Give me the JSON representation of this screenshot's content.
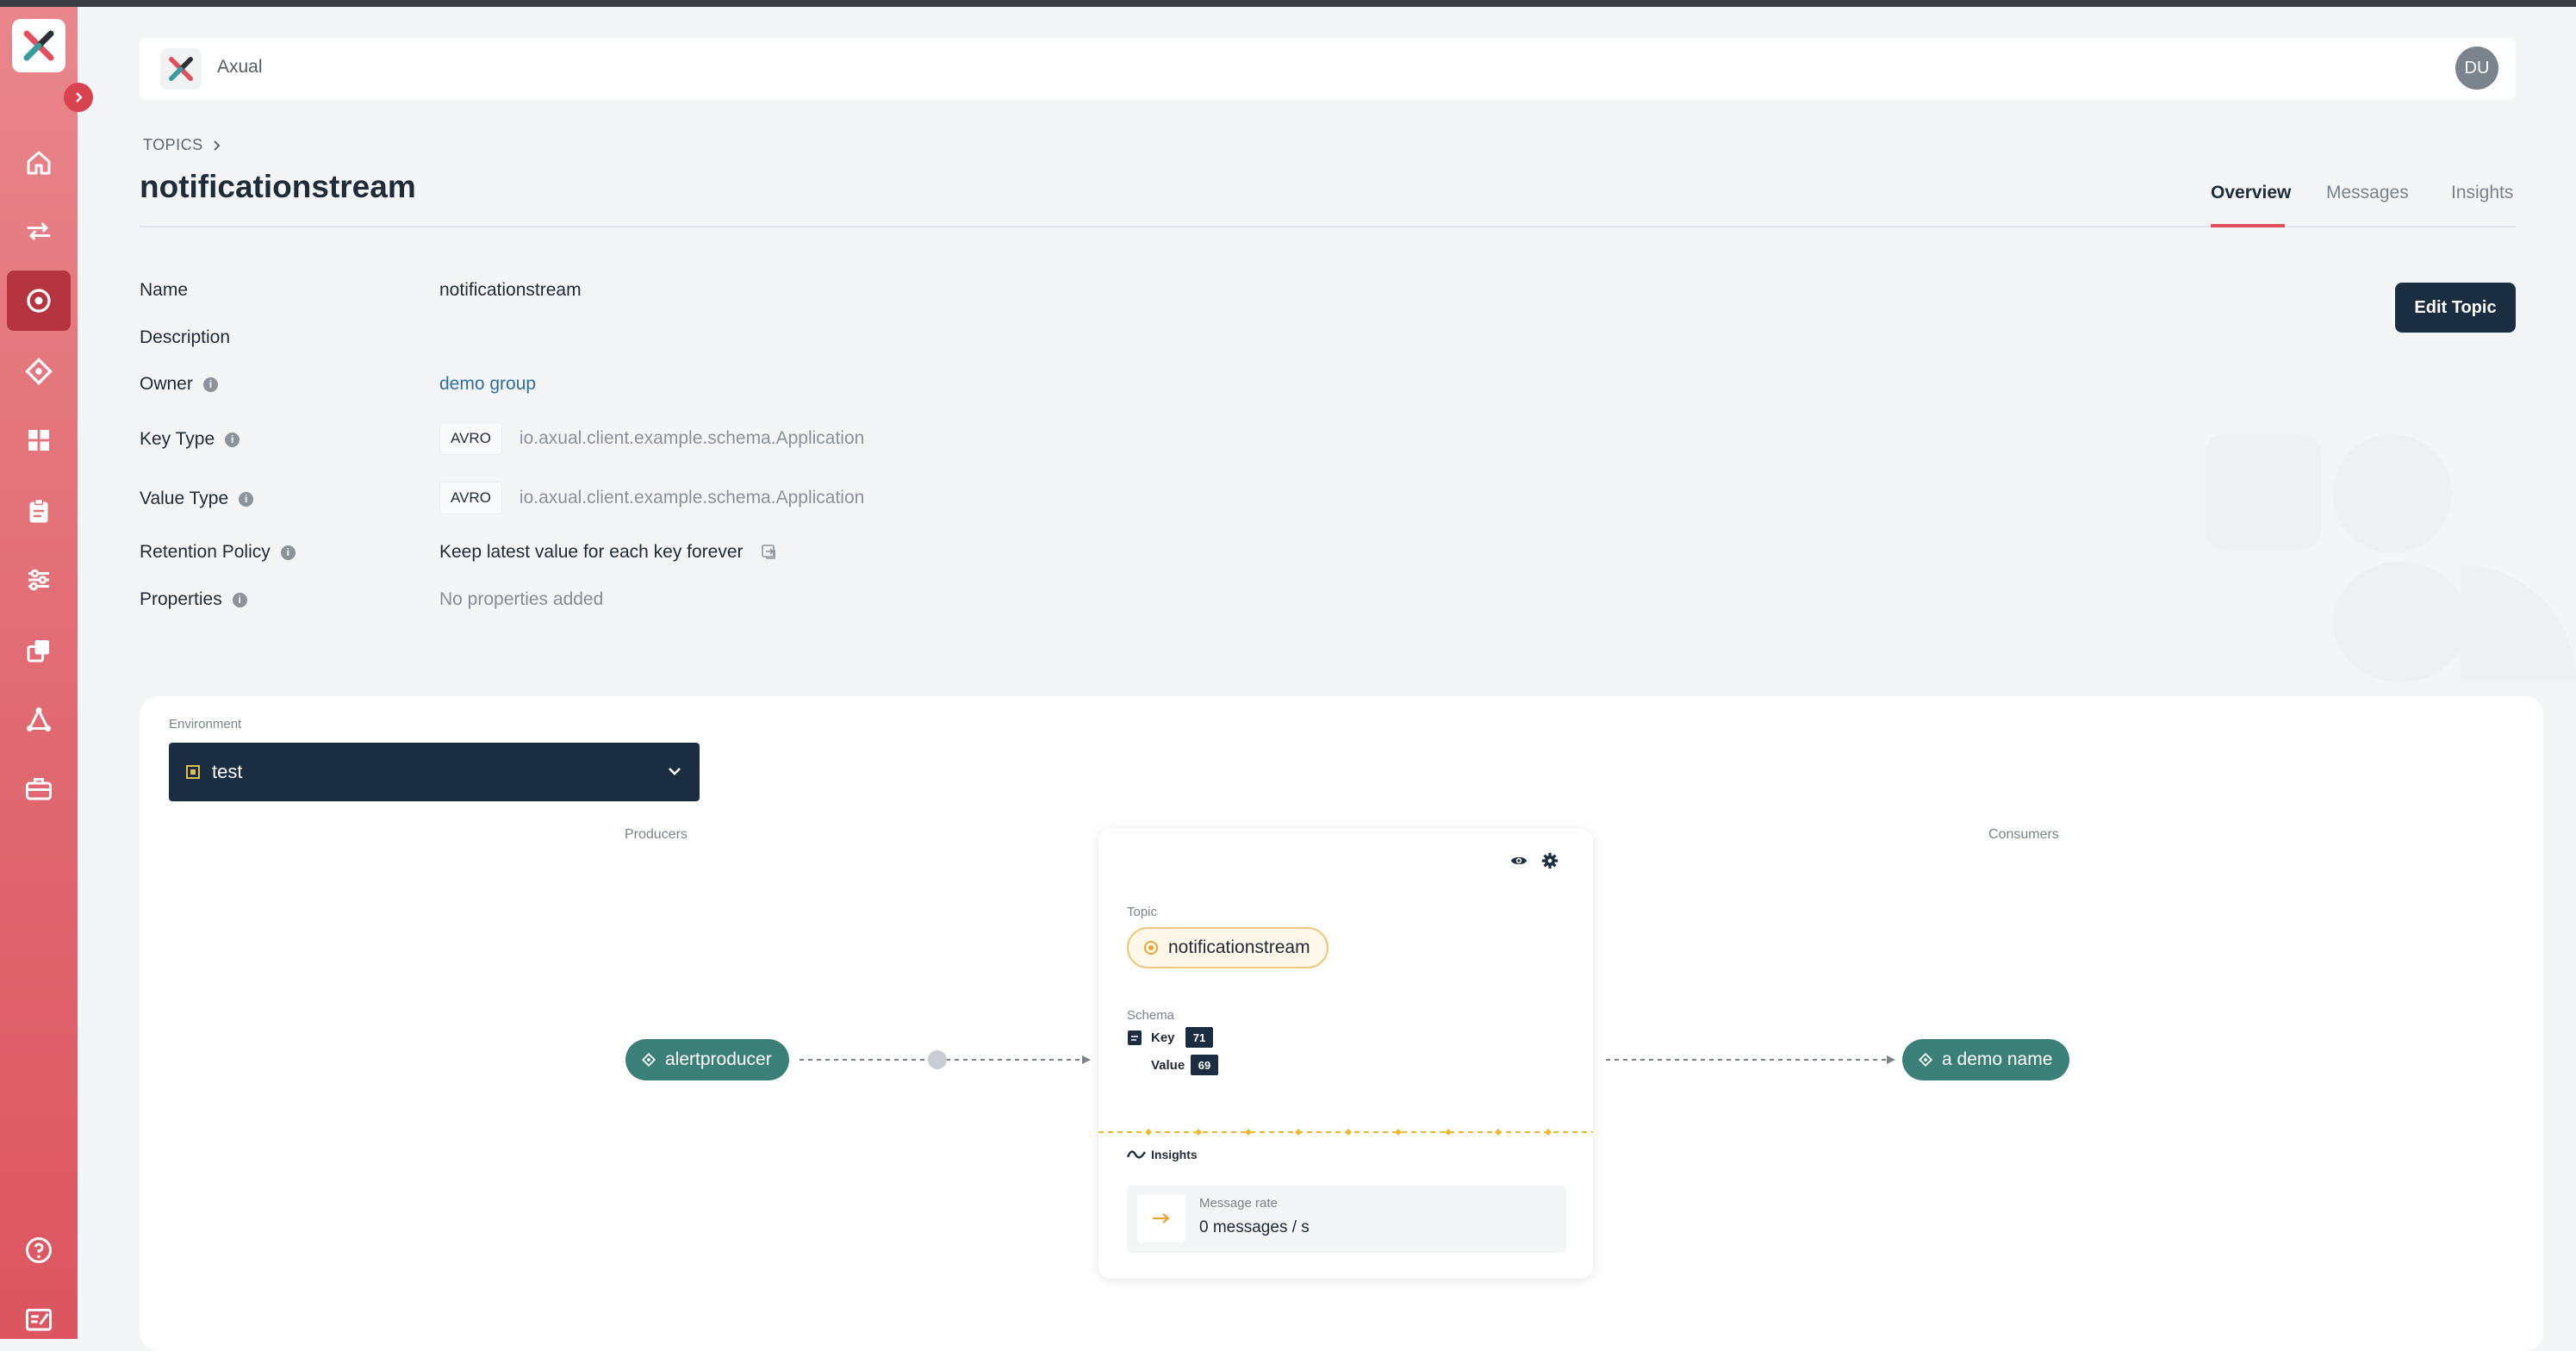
{
  "header": {
    "brand": "Axual",
    "avatar_initials": "DU"
  },
  "breadcrumb": {
    "section": "TOPICS"
  },
  "page": {
    "title": "notificationstream"
  },
  "tabs": [
    {
      "label": "Overview",
      "active": true
    },
    {
      "label": "Messages",
      "active": false
    },
    {
      "label": "Insights",
      "active": false
    }
  ],
  "actions": {
    "edit_label": "Edit Topic"
  },
  "properties": {
    "name_label": "Name",
    "name_value": "notificationstream",
    "description_label": "Description",
    "owner_label": "Owner",
    "owner_value": "demo group",
    "key_type_label": "Key Type",
    "key_type_badge": "AVRO",
    "key_type_name": "io.axual.client.example.schema.Application",
    "value_type_label": "Value Type",
    "value_type_badge": "AVRO",
    "value_type_name": "io.axual.client.example.schema.Application",
    "retention_label": "Retention Policy",
    "retention_value": "Keep latest value for each key forever",
    "properties_label": "Properties",
    "properties_value": "No properties added"
  },
  "environment": {
    "label": "Environment",
    "selected": "test"
  },
  "flow": {
    "producers_label": "Producers",
    "consumers_label": "Consumers",
    "producer": "alertproducer",
    "consumer": "a demo name",
    "topic_card": {
      "topic_label": "Topic",
      "topic_name": "notificationstream",
      "schema_label": "Schema",
      "key_label": "Key",
      "key_version": "71",
      "value_label": "Value",
      "value_version": "69",
      "insights_label": "Insights",
      "message_rate_label": "Message rate",
      "message_rate_value": "0 messages / s"
    }
  },
  "colors": {
    "sidebar": "#e26e76",
    "accent": "#e05060",
    "primary": "#1b2d40",
    "node": "#3a7f78",
    "topic_ring": "#e8a537"
  },
  "icons": {
    "sidebar": [
      "home-icon",
      "streams-icon",
      "topics-icon",
      "applications-icon",
      "dashboard-icon",
      "clipboard-icon",
      "settings-sliders-icon",
      "copy-icon",
      "network-icon",
      "toolbox-icon",
      "help-icon",
      "release-notes-icon"
    ],
    "card": [
      "eye-icon",
      "gear-icon",
      "schema-icon",
      "pulse-icon",
      "arrow-right-icon"
    ]
  }
}
